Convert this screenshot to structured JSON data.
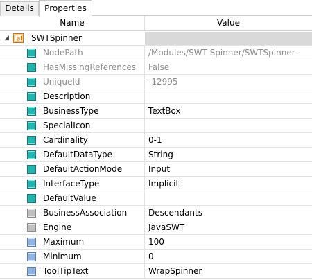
{
  "tabs": [
    {
      "label": "Details",
      "active": false
    },
    {
      "label": "Properties",
      "active": true
    }
  ],
  "columns": {
    "name": "Name",
    "value": "Value"
  },
  "root": {
    "label": "SWTSpinner",
    "expanded": true,
    "icon": "component-icon"
  },
  "properties": [
    {
      "name": "NodePath",
      "value": "/Modules/SWT Spinner/SWTSpinner",
      "readonly": true,
      "icon": "teal"
    },
    {
      "name": "HasMissingReferences",
      "value": "False",
      "readonly": true,
      "icon": "teal"
    },
    {
      "name": "UniqueId",
      "value": "-12995",
      "readonly": true,
      "icon": "teal"
    },
    {
      "name": "Description",
      "value": "",
      "readonly": false,
      "icon": "teal"
    },
    {
      "name": "BusinessType",
      "value": "TextBox",
      "readonly": false,
      "icon": "teal"
    },
    {
      "name": "SpecialIcon",
      "value": "",
      "readonly": false,
      "icon": "teal"
    },
    {
      "name": "Cardinality",
      "value": "0-1",
      "readonly": false,
      "icon": "teal"
    },
    {
      "name": "DefaultDataType",
      "value": "String",
      "readonly": false,
      "icon": "teal"
    },
    {
      "name": "DefaultActionMode",
      "value": "Input",
      "readonly": false,
      "icon": "teal"
    },
    {
      "name": "InterfaceType",
      "value": "Implicit",
      "readonly": false,
      "icon": "teal"
    },
    {
      "name": "DefaultValue",
      "value": "",
      "readonly": false,
      "icon": "teal"
    },
    {
      "name": "BusinessAssociation",
      "value": "Descendants",
      "readonly": false,
      "icon": "gray"
    },
    {
      "name": "Engine",
      "value": "JavaSWT",
      "readonly": false,
      "icon": "gray"
    },
    {
      "name": "Maximum",
      "value": "100",
      "readonly": false,
      "icon": "blue"
    },
    {
      "name": "Minimum",
      "value": "0",
      "readonly": false,
      "icon": "blue"
    },
    {
      "name": "ToolTipText",
      "value": "WrapSpinner",
      "readonly": false,
      "icon": "blue"
    }
  ],
  "colors": {
    "teal": "#1fb5b0",
    "gray": "#bfbfbf",
    "blue": "#8db3e2",
    "readonly_text": "#8c8c8c"
  }
}
